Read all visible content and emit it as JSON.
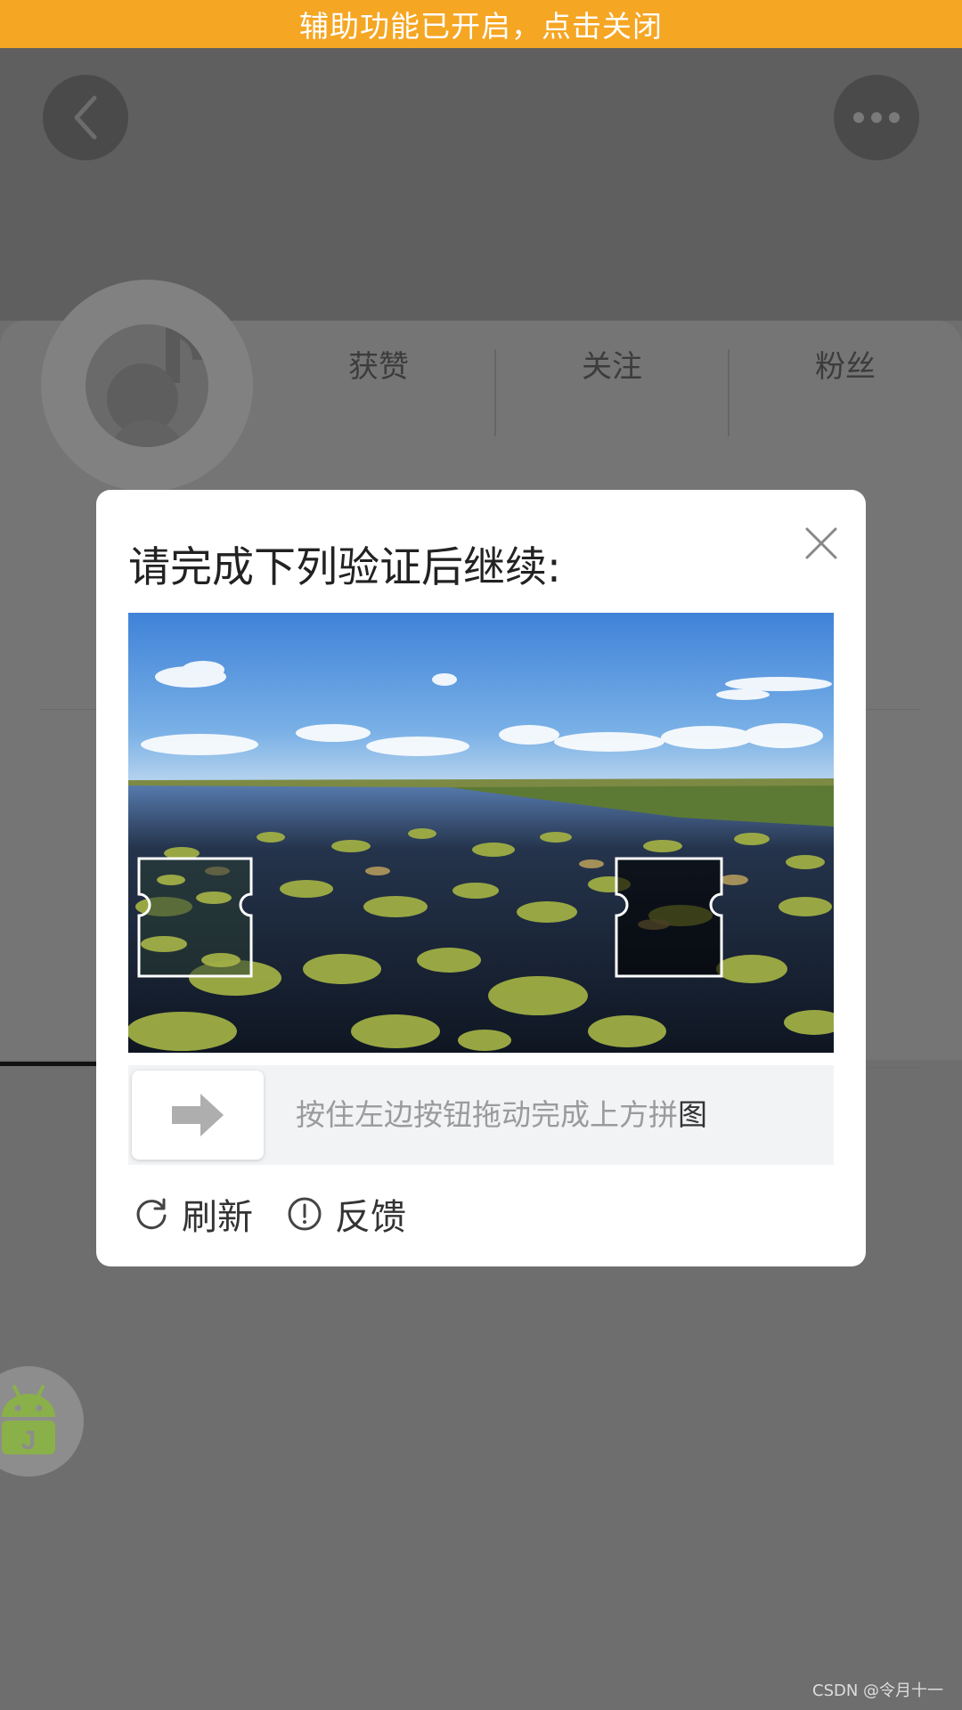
{
  "banner": {
    "text": "辅助功能已开启，点击关闭"
  },
  "profile": {
    "stats": [
      {
        "label": "获赞"
      },
      {
        "label": "关注"
      },
      {
        "label": "粉丝"
      }
    ]
  },
  "captcha": {
    "title": "请完成下列验证后继续:",
    "slider_hint_main": "按住左边按钮拖动完成上方拼",
    "slider_hint_last": "图",
    "refresh_label": "刷新",
    "feedback_label": "反馈"
  },
  "watermark": "CSDN @令月十一",
  "colors": {
    "banner": "#f5a623",
    "dialog_bg": "#ffffff",
    "slider_track": "#f2f3f5"
  }
}
